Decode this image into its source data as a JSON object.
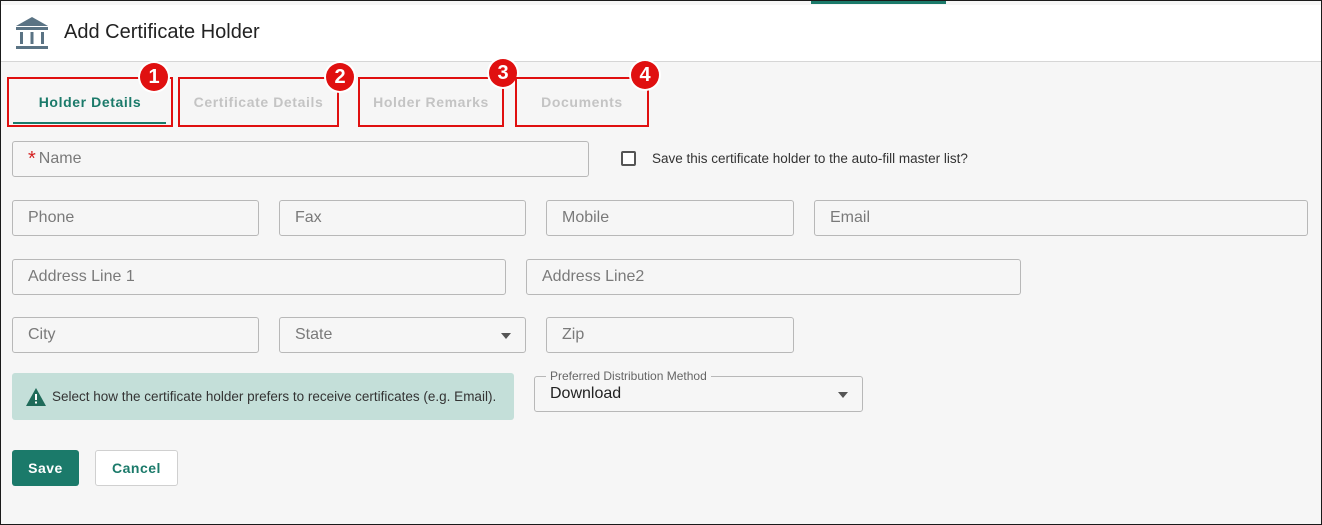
{
  "header": {
    "title": "Add Certificate Holder",
    "icon": "bank-icon"
  },
  "tabs": [
    {
      "label": "Holder Details",
      "badge": "1",
      "active": true
    },
    {
      "label": "Certificate Details",
      "badge": "2",
      "active": false
    },
    {
      "label": "Holder Remarks",
      "badge": "3",
      "active": false
    },
    {
      "label": "Documents",
      "badge": "4",
      "active": false
    }
  ],
  "form": {
    "name": {
      "required_mark": "*",
      "placeholder": "Name"
    },
    "save_to_master": {
      "label": "Save this certificate holder to the auto-fill master list?",
      "checked": false
    },
    "phone": {
      "placeholder": "Phone"
    },
    "fax": {
      "placeholder": "Fax"
    },
    "mobile": {
      "placeholder": "Mobile"
    },
    "email": {
      "placeholder": "Email"
    },
    "address1": {
      "placeholder": "Address Line 1"
    },
    "address2": {
      "placeholder": "Address Line2"
    },
    "city": {
      "placeholder": "City"
    },
    "state": {
      "placeholder": "State"
    },
    "zip": {
      "placeholder": "Zip"
    },
    "hint": "Select how the certificate holder prefers to receive certificates (e.g. Email).",
    "distribution": {
      "label": "Preferred Distribution Method",
      "value": "Download"
    }
  },
  "buttons": {
    "save": "Save",
    "cancel": "Cancel"
  },
  "colors": {
    "accent": "#1b7a6a",
    "annotation_red": "#e01010",
    "hint_background": "#c4dfd9"
  }
}
